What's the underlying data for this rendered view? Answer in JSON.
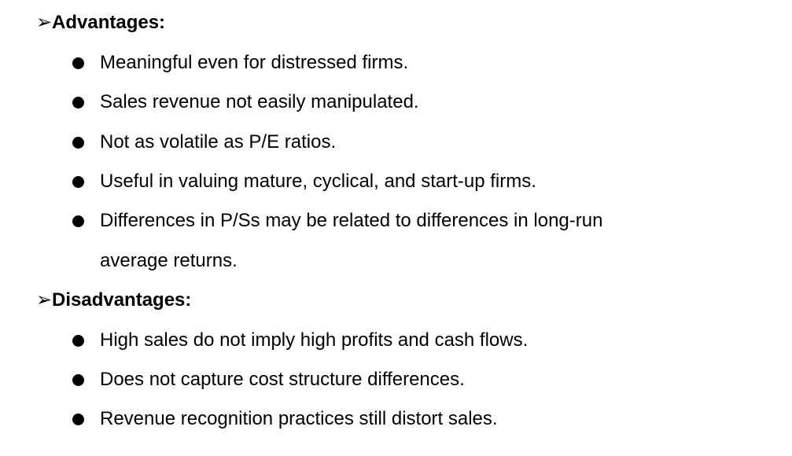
{
  "advantages": {
    "marker": "➢",
    "heading": "Advantages:",
    "items": [
      "Meaningful even for distressed firms.",
      "Sales revenue not easily manipulated.",
      "Not as volatile as P/E ratios.",
      "Useful in valuing mature, cyclical, and start-up firms.",
      "Differences in P/Ss may be related to differences in long-run"
    ],
    "continuation": "average returns."
  },
  "disadvantages": {
    "marker": "➢",
    "heading": "Disadvantages:",
    "items": [
      "High sales do not imply high profits and cash flows.",
      "Does not capture cost structure differences.",
      "Revenue recognition practices still distort sales."
    ]
  }
}
